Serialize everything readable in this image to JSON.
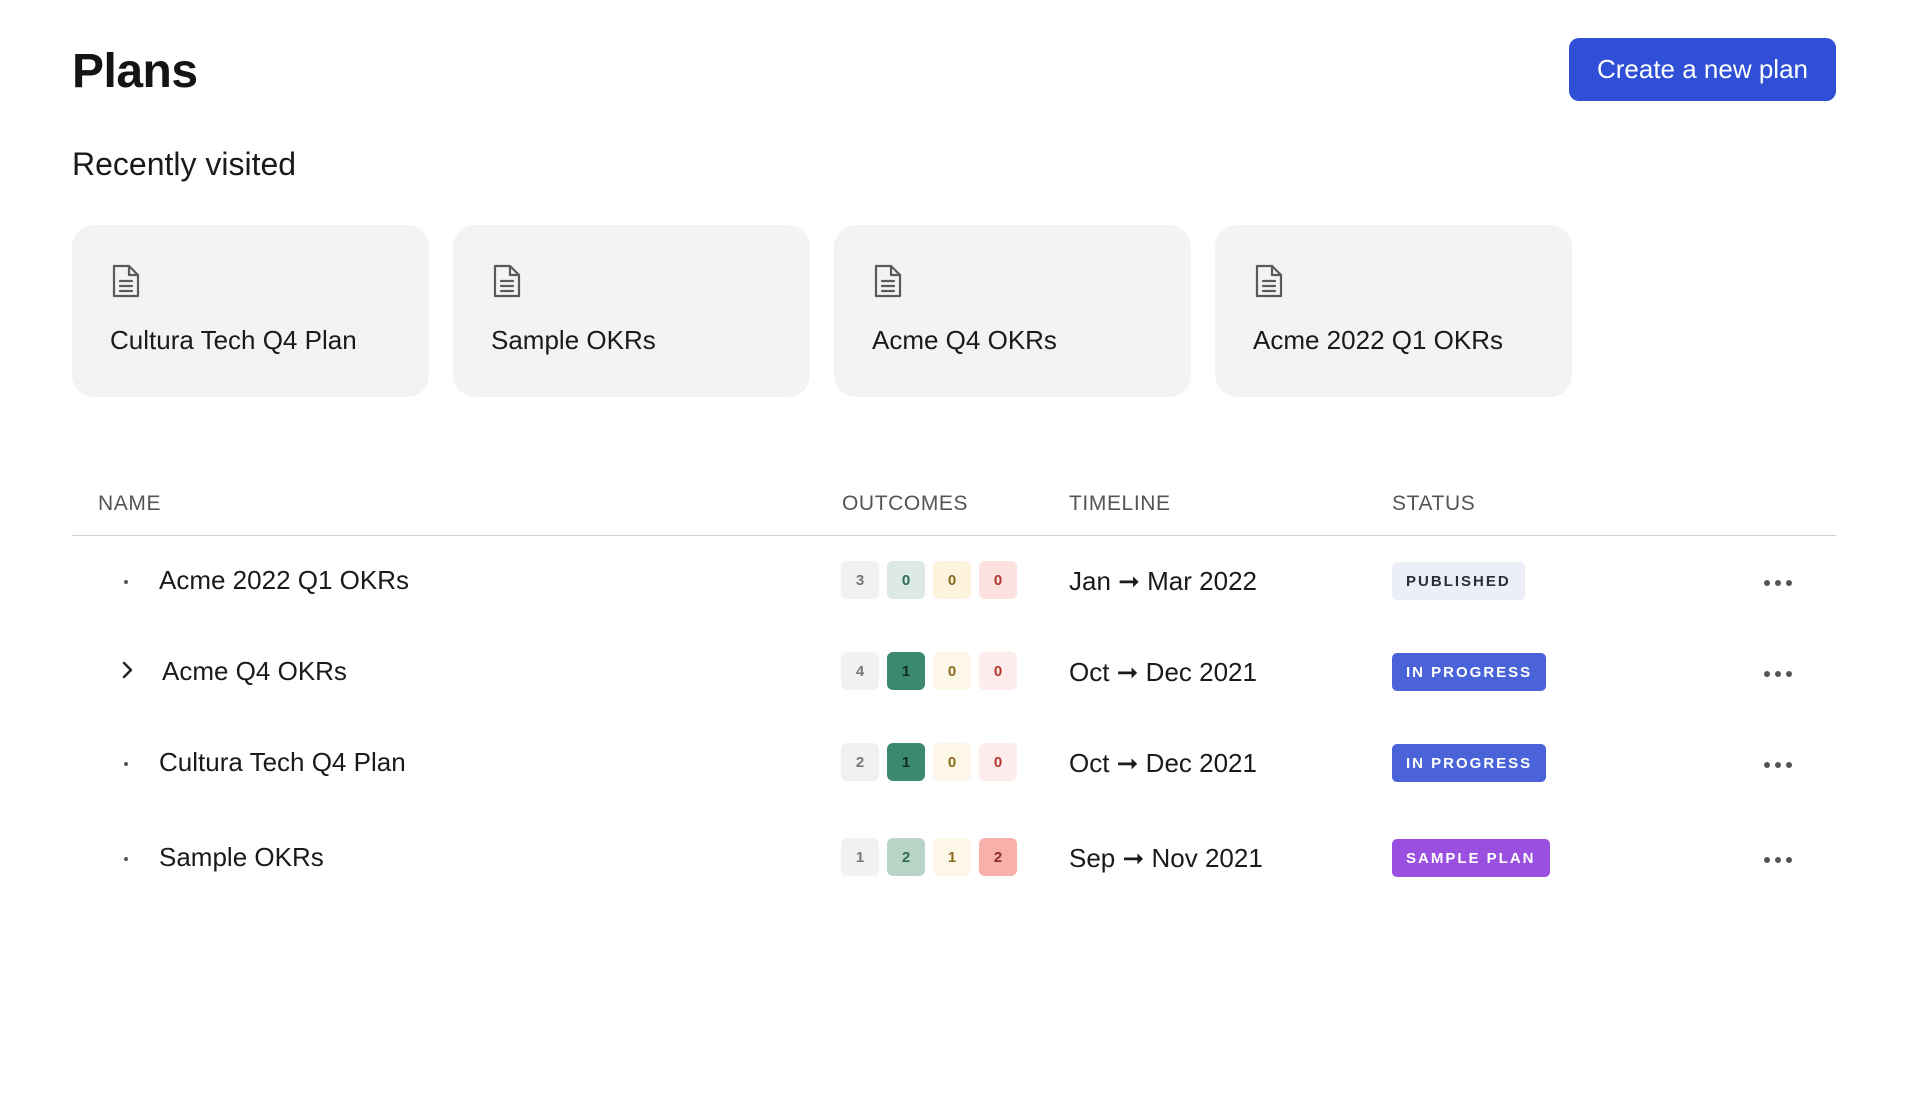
{
  "page": {
    "title": "Plans",
    "create_button": "Create a new plan"
  },
  "recent": {
    "title": "Recently visited",
    "items": [
      {
        "label": "Cultura Tech Q4 Plan",
        "icon": "document-icon"
      },
      {
        "label": "Sample OKRs",
        "icon": "document-icon"
      },
      {
        "label": "Acme Q4 OKRs",
        "icon": "document-icon"
      },
      {
        "label": "Acme 2022 Q1 OKRs",
        "icon": "document-icon"
      }
    ]
  },
  "table": {
    "columns": [
      "NAME",
      "OUTCOMES",
      "TIMELINE",
      "STATUS"
    ],
    "rows": [
      {
        "name": "Acme 2022 Q1 OKRs",
        "expandable": false,
        "outcomes": [
          "3",
          "0",
          "0",
          "0"
        ],
        "timeline": "Jan ➞ Mar 2022",
        "status": "PUBLISHED",
        "status_style": "published"
      },
      {
        "name": "Acme Q4 OKRs",
        "expandable": true,
        "outcomes": [
          "4",
          "1",
          "0",
          "0"
        ],
        "timeline": "Oct ➞ Dec 2021",
        "status": "IN PROGRESS",
        "status_style": "in-progress"
      },
      {
        "name": "Cultura Tech Q4 Plan",
        "expandable": false,
        "outcomes": [
          "2",
          "1",
          "0",
          "0"
        ],
        "timeline": "Oct ➞ Dec 2021",
        "status": "IN PROGRESS",
        "status_style": "in-progress"
      },
      {
        "name": "Sample OKRs",
        "expandable": false,
        "outcomes": [
          "1",
          "2",
          "1",
          "2"
        ],
        "timeline": "Sep ➞ Nov 2021",
        "status": "SAMPLE PLAN",
        "status_style": "sample"
      }
    ]
  },
  "colors": {
    "primary": "#2e4fd6",
    "in_progress": "#4a63d8",
    "published_bg": "#eceef8",
    "published_text": "#2a2d3a",
    "sample": "#9a4fe0",
    "outcome_neutral_bg": "#f1f1f1",
    "outcome_neutral_text": "#777777",
    "outcome_green_light_bg": "#dde9e3",
    "outcome_green_dark_bg": "#3b8a6e",
    "outcome_green_mid_bg": "#b8d4c6",
    "outcome_yellow_bg": "#fdf3dc",
    "outcome_red_bg": "#fde1df",
    "outcome_red_strong_bg": "#f7b0aa"
  }
}
